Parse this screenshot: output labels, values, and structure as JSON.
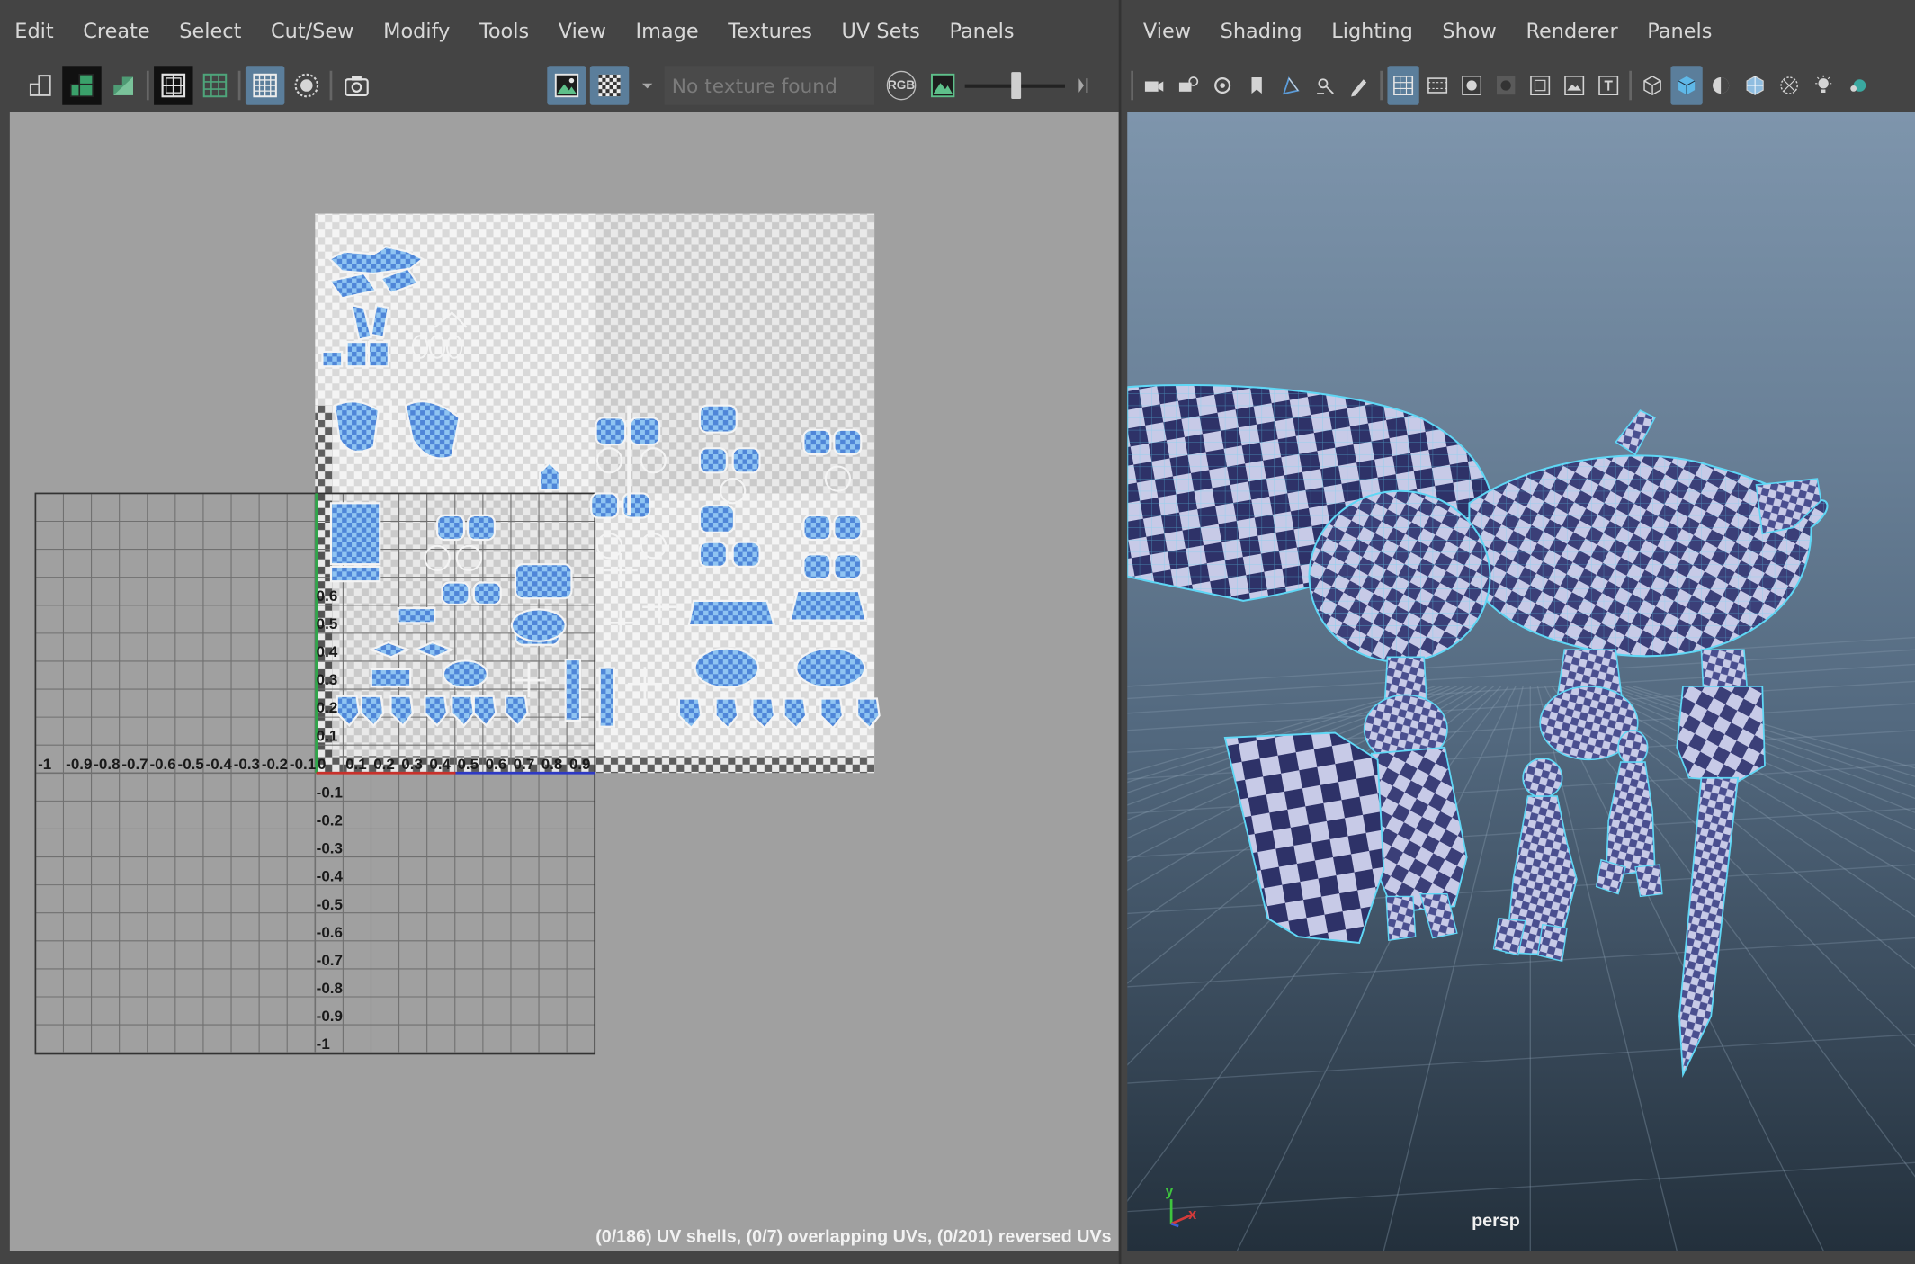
{
  "uv_editor": {
    "menu": [
      "Edit",
      "Create",
      "Select",
      "Cut/Sew",
      "Modify",
      "Tools",
      "View",
      "Image",
      "Textures",
      "UV Sets",
      "Panels"
    ],
    "toolbar": {
      "icons": [
        "uv-shell-icon",
        "uv-tile-icon",
        "uv-shaded-icon",
        "grid-frame-icon",
        "grid-icon",
        "pixel-grid-icon",
        "wireframe-circle-icon",
        "snapshot-camera-icon",
        "image-display-icon",
        "checker-icon",
        "dropdown-arrow-icon",
        "rgb-channels-icon",
        "exposure-icon",
        "arrow-right-icon"
      ],
      "texture_field": "No texture found",
      "rgb_label": "RGB",
      "exposure_slider": 0.52
    },
    "u_ticks": [
      "-1",
      "-0.9",
      "-0.8",
      "-0.7",
      "-0.6",
      "-0.5",
      "-0.4",
      "-0.3",
      "-0.2",
      "-0.1",
      "0",
      "0.1",
      "0.2",
      "0.3",
      "0.4",
      "0.5",
      "0.6",
      "0.7",
      "0.8",
      "0.9"
    ],
    "v_ticks_pos": [
      "0.6",
      "0.5",
      "0.4",
      "0.3",
      "0.2",
      "0.1"
    ],
    "v_ticks_neg": [
      "-0.1",
      "-0.2",
      "-0.3",
      "-0.4",
      "-0.5",
      "-0.6",
      "-0.7",
      "-0.8",
      "-0.9",
      "-1"
    ],
    "status": "(0/186) UV shells, (0/7) overlapping UVs, (0/201) reversed UVs"
  },
  "viewport": {
    "menu": [
      "View",
      "Shading",
      "Lighting",
      "Show",
      "Renderer",
      "Panels"
    ],
    "toolbar": {
      "icons": [
        "select-camera-icon",
        "camera-attributes-icon",
        "camera-lock-icon",
        "bookmark-icon",
        "image-plane-icon",
        "two-d-pan-icon",
        "grease-pencil-icon",
        "grid-icon",
        "film-gate-icon",
        "resolution-gate-icon",
        "gate-mask-icon",
        "field-chart-icon",
        "safe-action-icon",
        "safe-title-icon",
        "wireframe-icon",
        "smooth-shade-icon",
        "flat-shade-icon",
        "wireframe-on-shaded-icon",
        "xray-icon",
        "lights-icon",
        "ambient-occlusion-icon"
      ]
    },
    "camera_label": "persp",
    "axis_y": "y",
    "axis_x": "x",
    "colors": {
      "wire": "#5fd7f5",
      "checker_dark": "#3b3f78",
      "checker_light": "#c7cae7"
    }
  }
}
